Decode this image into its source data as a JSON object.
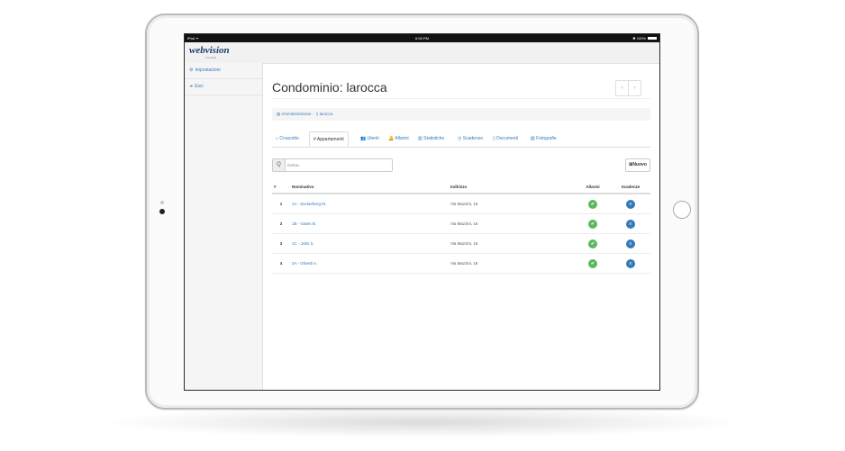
{
  "statusbar": {
    "device": "iPad ᯤ",
    "time": "6:50 PM",
    "battery": "✱ 100%"
  },
  "brand": {
    "logo": "webvision",
    "sub": "CALDAN"
  },
  "sidebar": {
    "items": [
      {
        "icon": "⚙",
        "icon_name": "gears-icon",
        "label": "Impostazioni"
      },
      {
        "icon": "➜",
        "icon_name": "sign-out-icon",
        "label": "Esci"
      }
    ]
  },
  "page": {
    "title": "Condominio: larocca",
    "pager_prev": "‹",
    "pager_next": "›"
  },
  "breadcrumb": {
    "items": [
      {
        "icon": "▤",
        "label": "Amministrazione"
      },
      {
        "icon": "▯",
        "label": "larocca"
      }
    ],
    "separator": "/"
  },
  "tabs": [
    {
      "icon": "⌂",
      "label": "Cruscotto",
      "active": false
    },
    {
      "icon": "#",
      "label": "Appartamenti",
      "active": true
    },
    {
      "icon": "👥",
      "label": "Utenti",
      "active": false
    },
    {
      "icon": "🔔",
      "label": "Allarmi",
      "active": false
    },
    {
      "icon": "▥",
      "label": "Statistiche",
      "active": false
    },
    {
      "icon": "◷",
      "label": "Scadenze",
      "active": false
    },
    {
      "icon": "▯",
      "label": "Documenti",
      "active": false
    },
    {
      "icon": "▨",
      "label": "Fotografie",
      "active": false
    }
  ],
  "search": {
    "icon": "Q",
    "placeholder": "Cerca.."
  },
  "new_button": {
    "icon": "⊞",
    "label": "Nuovo"
  },
  "table": {
    "headers": [
      "#",
      "Nominativo",
      "Indirizzo",
      "Allarmi",
      "Scadenze"
    ],
    "rows": [
      {
        "num": "1",
        "name": "1A - Zuckerberg M.",
        "address": "Via Mazzini, 16",
        "alarm": "✔",
        "due": "≡"
      },
      {
        "num": "2",
        "name": "1B - Gates B.",
        "address": "Via Mazzini, 16",
        "alarm": "✔",
        "due": "≡"
      },
      {
        "num": "3",
        "name": "1C - Jobs S.",
        "address": "Via Mazzini, 16",
        "alarm": "✔",
        "due": "≡"
      },
      {
        "num": "4",
        "name": "2A - Olivetti A.",
        "address": "Via Mazzini, 16",
        "alarm": "✔",
        "due": "≡"
      }
    ]
  },
  "colors": {
    "link": "#337ab7",
    "ok": "#5cb85c",
    "due": "#337ab7"
  }
}
